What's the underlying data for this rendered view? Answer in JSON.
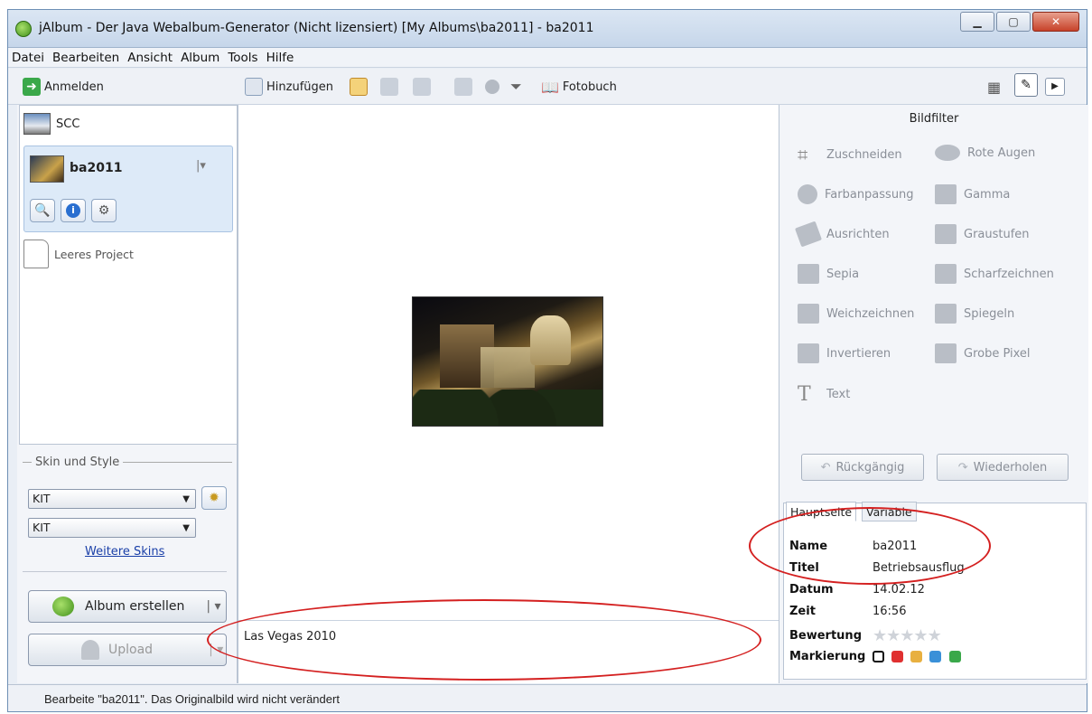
{
  "window": {
    "title": "jAlbum - Der Java Webalbum-Generator (Nicht lizensiert) [My Albums\\ba2011] - ba2011"
  },
  "menu": [
    "Datei",
    "Bearbeiten",
    "Ansicht",
    "Album",
    "Tools",
    "Hilfe"
  ],
  "toolbar": {
    "login_label": "Anmelden",
    "add_label": "Hinzufügen",
    "photobook_label": "Fotobuch"
  },
  "albums": {
    "item1": "SCC",
    "item2": "ba2011",
    "empty_project": "Leeres Project"
  },
  "skin": {
    "section_label": "Skin und Style",
    "skin_value": "KIT",
    "style_value": "KIT",
    "more_skins": "Weitere Skins"
  },
  "actions": {
    "make_album": "Album erstellen",
    "upload": "Upload"
  },
  "editor": {
    "caption": "Las Vegas 2010"
  },
  "filters": {
    "title": "Bildfilter",
    "items": [
      "Zuschneiden",
      "Rote Augen",
      "Farbanpassung",
      "Gamma",
      "Ausrichten",
      "Graustufen",
      "Sepia",
      "Scharfzeichnen",
      "Weichzeichnen",
      "Spiegeln",
      "Invertieren",
      "Grobe Pixel",
      "Text"
    ],
    "undo": "Rückgängig",
    "redo": "Wiederholen"
  },
  "props": {
    "tabs": [
      "Hauptseite",
      "Variable"
    ],
    "rows": [
      {
        "key": "Name",
        "value": "ba2011"
      },
      {
        "key": "Titel",
        "value": "Betriebsausflug"
      },
      {
        "key": "Datum",
        "value": "14.02.12"
      },
      {
        "key": "Zeit",
        "value": "16:56"
      },
      {
        "key": "Bewertung",
        "value": ""
      },
      {
        "key": "Markierung",
        "value": ""
      }
    ],
    "rating": 0,
    "marker_colors": [
      "#ffffff",
      "#e03030",
      "#e8b040",
      "#3a90d8",
      "#3aa84a"
    ]
  },
  "status": {
    "text": "Bearbeite \"ba2011\". Das Originalbild wird nicht verändert"
  }
}
